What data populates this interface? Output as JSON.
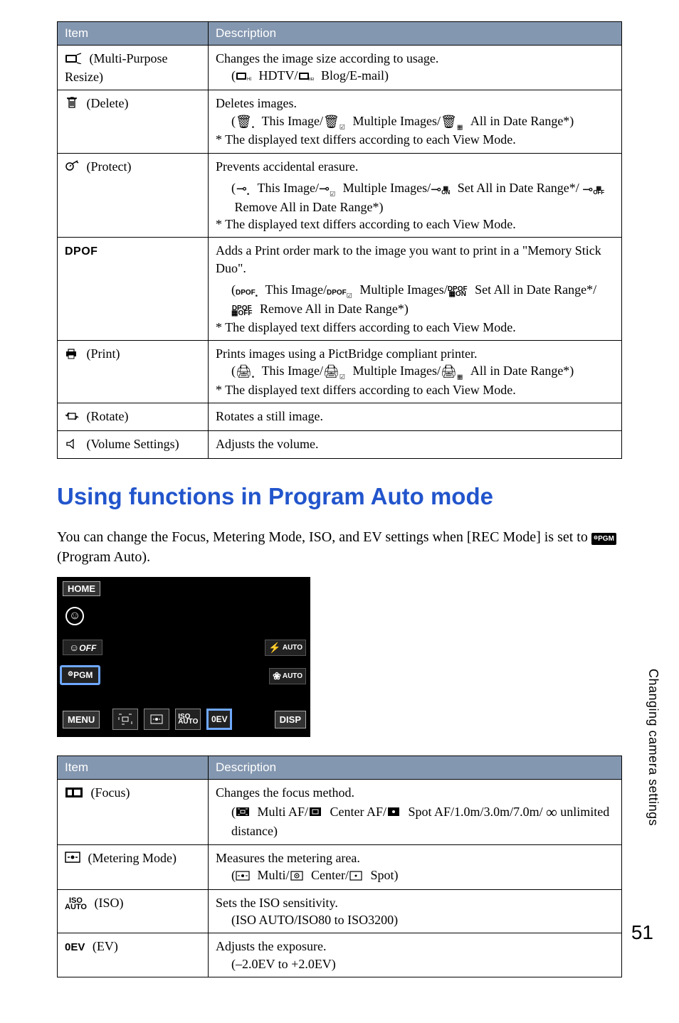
{
  "table1": {
    "headers": {
      "item": "Item",
      "description": "Description"
    },
    "rows": [
      {
        "item_icon": "resize-icon",
        "item_label": "(Multi-Purpose Resize)",
        "desc_main": "Changes the image size according to usage.",
        "desc_sub": "HDTV/",
        "desc_sub2": "Blog/E-mail)"
      },
      {
        "item_icon": "trash-icon",
        "item_label": "(Delete)",
        "desc_main": "Deletes images.",
        "desc_line2a": "This Image/",
        "desc_line2b": "Multiple Images/",
        "desc_line2c": "All in Date Range*)",
        "desc_note": "* The displayed text differs according to each View Mode."
      },
      {
        "item_icon": "protect-icon",
        "item_label": "(Protect)",
        "desc_main": "Prevents accidental erasure.",
        "desc_line2a": "This Image/",
        "desc_line2b": "Multiple Images/",
        "desc_line2c": "Set All in Date Range*/",
        "desc_line3": "Remove All in Date Range*)",
        "desc_note": "* The displayed text differs according to each View Mode."
      },
      {
        "item_icon": "dpof-icon",
        "item_label_dpof": "DPOF",
        "desc_main": "Adds a Print order mark to the image you want to print in a \"Memory Stick Duo\".",
        "desc_line2a": "This Image/",
        "desc_line2b": "Multiple Images/",
        "desc_line2c": "Set All in Date Range*/",
        "desc_line3": "Remove All in Date Range*)",
        "desc_note": "* The displayed text differs according to each View Mode."
      },
      {
        "item_icon": "print-icon",
        "item_label": "(Print)",
        "desc_main": "Prints images using a PictBridge compliant printer.",
        "desc_line2a": "This Image/",
        "desc_line2b": "Multiple Images/",
        "desc_line2c": "All in Date Range*)",
        "desc_note": "* The displayed text differs according to each View Mode."
      },
      {
        "item_icon": "rotate-icon",
        "item_label": "(Rotate)",
        "desc_main": "Rotates a still image."
      },
      {
        "item_icon": "volume-icon",
        "item_label": "(Volume Settings)",
        "desc_main": "Adjusts the volume."
      }
    ]
  },
  "section_heading": "Using functions in Program Auto mode",
  "intro_text_1": "You can change the Focus, Metering Mode, ISO, and EV settings when [REC Mode] is set to ",
  "intro_text_pgm": "PGM",
  "intro_text_2": " (Program Auto).",
  "ui": {
    "home": "HOME",
    "off": "OFF",
    "pgm": "PGM",
    "flash_auto": "AUTO",
    "macro_auto": "AUTO",
    "menu": "MENU",
    "iso_top": "ISO",
    "iso_bot": "AUTO",
    "ev_label": "0EV",
    "disp": "DISP"
  },
  "table2": {
    "headers": {
      "item": "Item",
      "description": "Description"
    },
    "rows": [
      {
        "item_icon": "focus-icon",
        "item_label": "(Focus)",
        "desc_main": "Changes the focus method.",
        "desc_line2a": "Multi AF/",
        "desc_line2b": "Center AF/",
        "desc_line2c": "Spot AF/1.0m/3.0m/7.0m/",
        "desc_line3": "unlimited distance)"
      },
      {
        "item_icon": "metering-icon",
        "item_label": "(Metering Mode)",
        "desc_main": "Measures the metering area.",
        "desc_line2a": "Multi/",
        "desc_line2b": "Center/",
        "desc_line2c": "Spot)"
      },
      {
        "item_icon": "iso-icon",
        "item_top": "ISO",
        "item_bot": "AUTO",
        "item_label": "(ISO)",
        "desc_main": "Sets the ISO sensitivity.",
        "desc_line2": "(ISO AUTO/ISO80 to ISO3200)"
      },
      {
        "item_icon": "ev-icon",
        "item_ev": "0EV",
        "item_label": "(EV)",
        "desc_main": "Adjusts the exposure.",
        "desc_line2": "(–2.0EV to +2.0EV)"
      }
    ]
  },
  "side_tab": "Changing camera settings",
  "page_number": "51"
}
